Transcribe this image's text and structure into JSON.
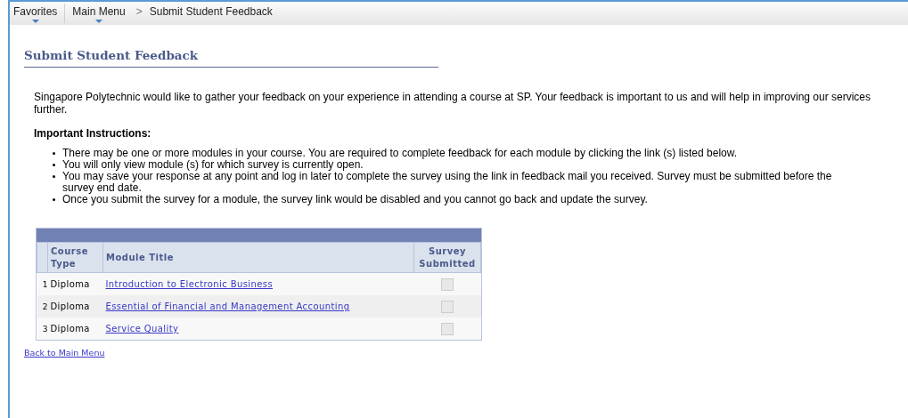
{
  "breadcrumb": {
    "items": [
      {
        "label": "Favorites",
        "kind": "menu"
      },
      {
        "label": "Main Menu",
        "kind": "menu"
      },
      {
        "label": "Submit Student Feedback",
        "kind": "page"
      }
    ],
    "separator": ">"
  },
  "page_title": "Submit Student Feedback",
  "intro": "Singapore Polytechnic would like to gather your feedback on your experience in attending a course at SP. Your feedback is important to us and will help in improving our services further.",
  "instructions_heading": "Important Instructions:",
  "instructions": [
    "There may be one or more modules in your course. You are required to complete feedback for each module by clicking the link (s) listed below.",
    "You will only view module (s) for which survey is currently open.",
    "You may save your response at any point and log in later to complete the survey using the link in feedback mail you received. Survey must be submitted before the survey end date.",
    "Once you submit the survey for a module, the survey link would be disabled and you cannot go back and update the survey."
  ],
  "table": {
    "columns": [
      "Course Type",
      "Module Title",
      "Survey Submitted"
    ],
    "rows": [
      {
        "number": "1",
        "course_type": "Diploma",
        "module_title": "Introduction to Electronic Business",
        "survey_submitted": {
          "checked": false,
          "disabled": true
        }
      },
      {
        "number": "2",
        "course_type": "Diploma",
        "module_title": "Essential of Financial and Management Accounting",
        "survey_submitted": {
          "checked": false,
          "disabled": true
        }
      },
      {
        "number": "3",
        "course_type": "Diploma",
        "module_title": "Service Quality",
        "survey_submitted": {
          "checked": false,
          "disabled": true
        }
      }
    ]
  },
  "back_link": "Back to Main Menu"
}
